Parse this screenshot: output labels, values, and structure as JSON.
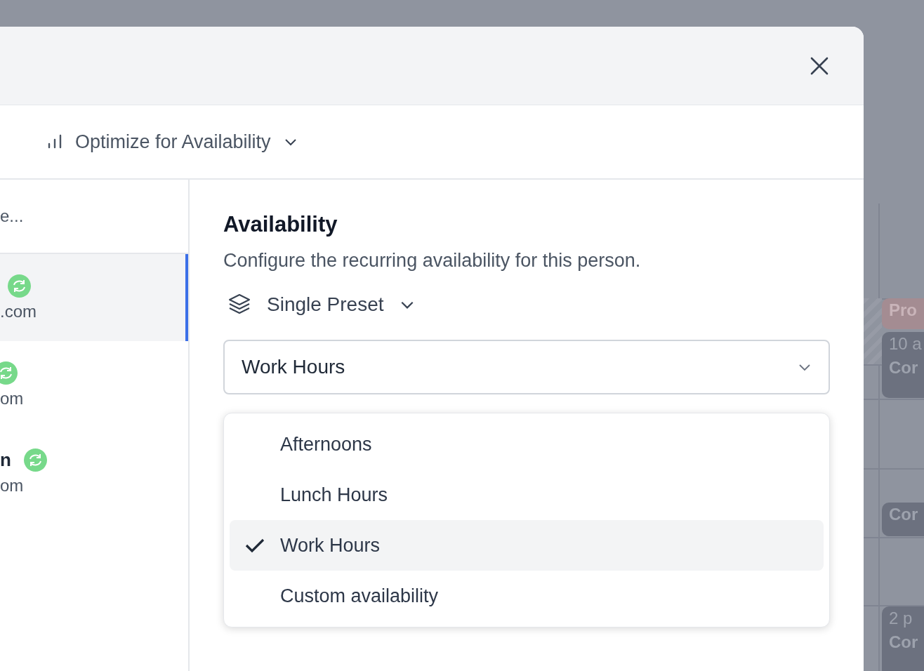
{
  "dialog": {
    "toolbar": {
      "optimize_label": "Optimize for Availability"
    },
    "people": {
      "search_placeholder": "e...",
      "items": [
        {
          "email": ".com",
          "selected": true,
          "synced": true
        },
        {
          "email": "om",
          "selected": false,
          "synced": true
        },
        {
          "name": "n",
          "email": "om",
          "selected": false,
          "synced": true
        }
      ]
    },
    "availability": {
      "title": "Availability",
      "description": "Configure the recurring availability for this person.",
      "preset_mode": "Single Preset",
      "preset_value": "Work Hours",
      "options": [
        {
          "label": "Afternoons",
          "selected": false
        },
        {
          "label": "Lunch Hours",
          "selected": false
        },
        {
          "label": "Work Hours",
          "selected": true
        },
        {
          "label": "Custom availability",
          "selected": false
        }
      ]
    }
  },
  "calendar": {
    "events": [
      {
        "kind": "tentative",
        "lines": [
          "Pro"
        ]
      },
      {
        "kind": "busy",
        "lines": [
          "10 a",
          "Cor"
        ]
      },
      {
        "kind": "busy",
        "lines": [
          "Cor"
        ]
      },
      {
        "kind": "busy",
        "lines": [
          "2 p",
          "Cor"
        ]
      }
    ]
  }
}
